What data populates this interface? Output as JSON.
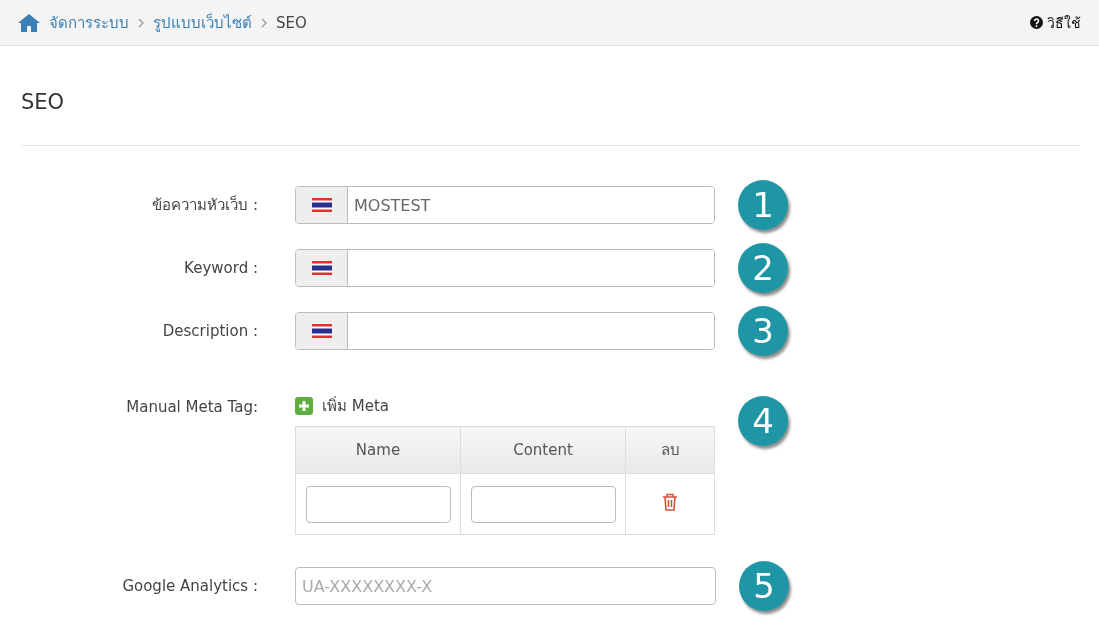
{
  "breadcrumb": [
    {
      "label": "จัดการระบบ",
      "kind": "link"
    },
    {
      "label": "รูปแบบเว็บไซต์",
      "kind": "link"
    },
    {
      "label": "SEO",
      "kind": "current"
    }
  ],
  "help": {
    "label": "วิธีใช้"
  },
  "title": "SEO",
  "rows": [
    {
      "kind": "lang-input",
      "label": "ข้อความหัวเว็บ :",
      "value": "MOSTEST",
      "badge": "1"
    },
    {
      "kind": "lang-input",
      "label": "Keyword :",
      "value": "",
      "badge": "2"
    },
    {
      "kind": "lang-input",
      "label": "Description :",
      "value": "",
      "badge": "3"
    },
    {
      "kind": "meta",
      "label": "Manual Meta Tag:",
      "add": "เพิ่ม Meta",
      "columns": [
        "Name",
        "Content",
        "ลบ"
      ],
      "badge": "4"
    },
    {
      "kind": "input",
      "label": "Google Analytics :",
      "placeholder": "UA-XXXXXXXX-X",
      "badge": "5"
    }
  ]
}
